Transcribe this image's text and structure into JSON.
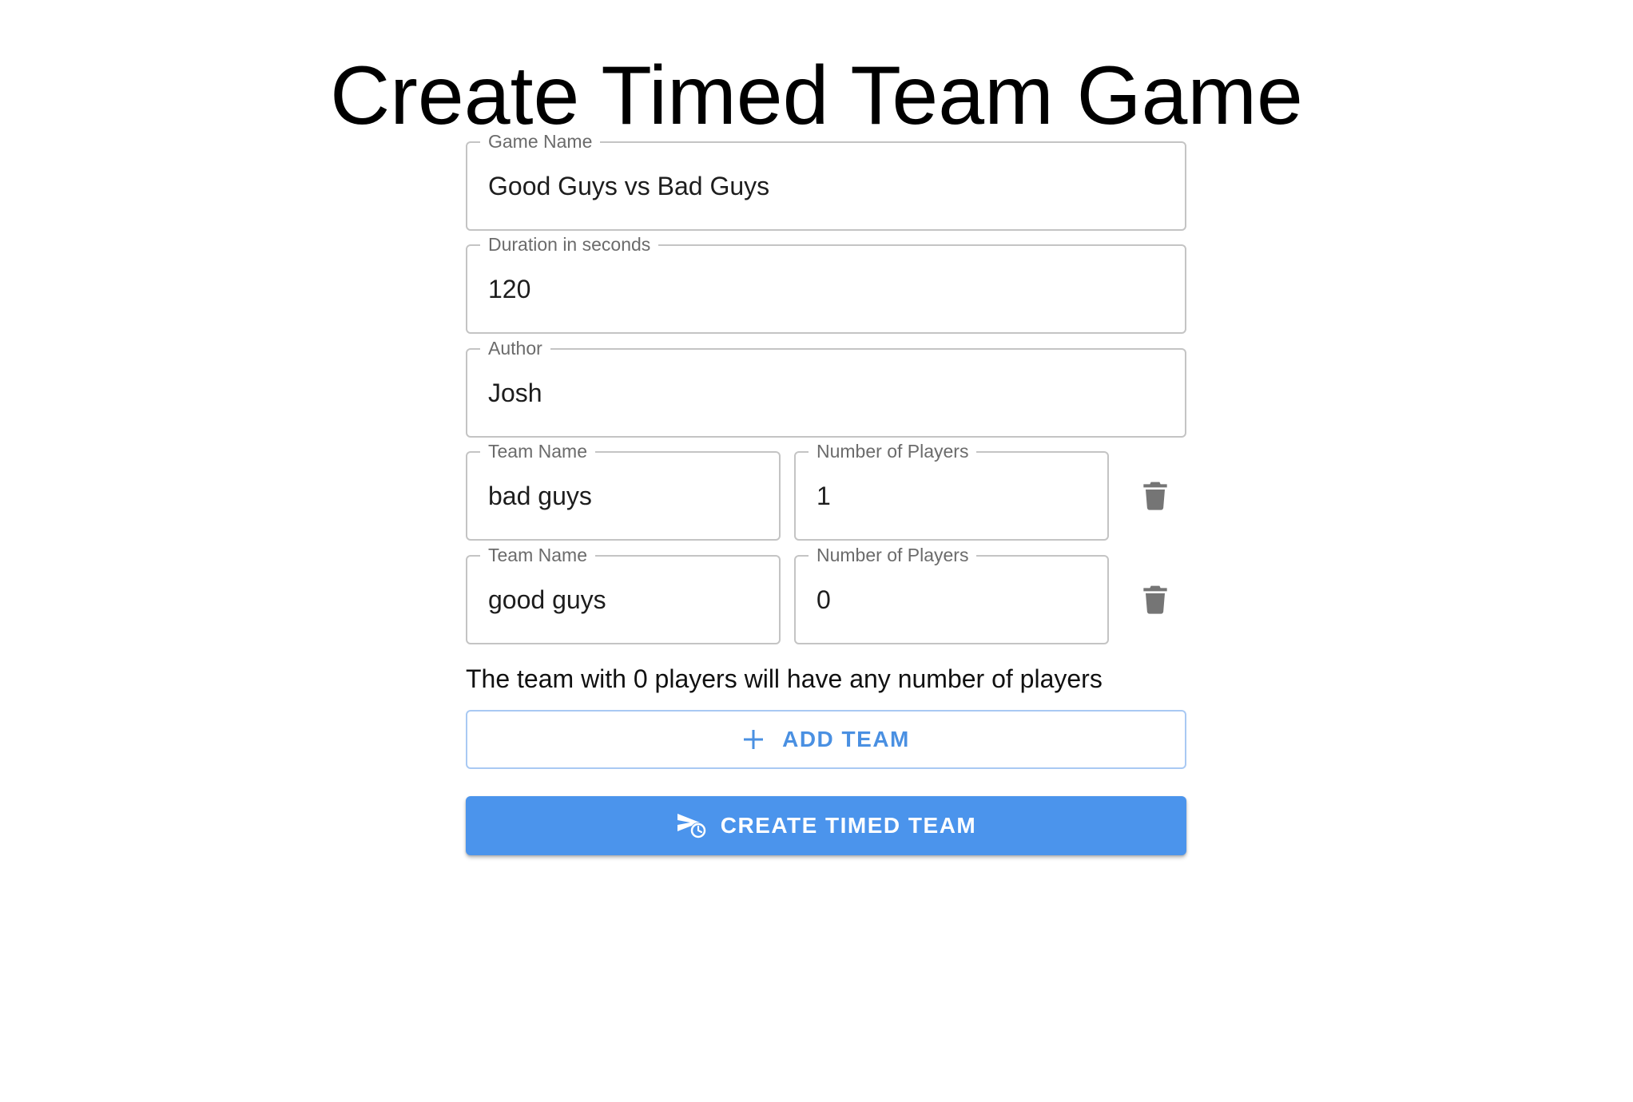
{
  "page": {
    "title": "Create Timed Team Game"
  },
  "form": {
    "game_name": {
      "label": "Game Name",
      "value": "Good Guys vs Bad Guys"
    },
    "duration": {
      "label": "Duration in seconds",
      "value": "120"
    },
    "author": {
      "label": "Author",
      "value": "Josh"
    }
  },
  "teams": [
    {
      "name_label": "Team Name",
      "name_value": "bad guys",
      "players_label": "Number of Players",
      "players_value": "1",
      "delete_icon": "trash-icon"
    },
    {
      "name_label": "Team Name",
      "name_value": "good guys",
      "players_label": "Number of Players",
      "players_value": "0",
      "delete_icon": "trash-icon"
    }
  ],
  "helper_text": "The team with 0 players will have any number of players",
  "add_team": {
    "label": "ADD TEAM",
    "icon": "plus-icon"
  },
  "create_button": {
    "label": "CREATE TIMED TEAM",
    "icon": "send-clock-icon"
  },
  "colors": {
    "primary": "#4b94ec",
    "outline_primary": "#a9c9f3",
    "field_border": "#c4c4c4",
    "label_gray": "#6b6b6b",
    "icon_gray": "#757575"
  }
}
